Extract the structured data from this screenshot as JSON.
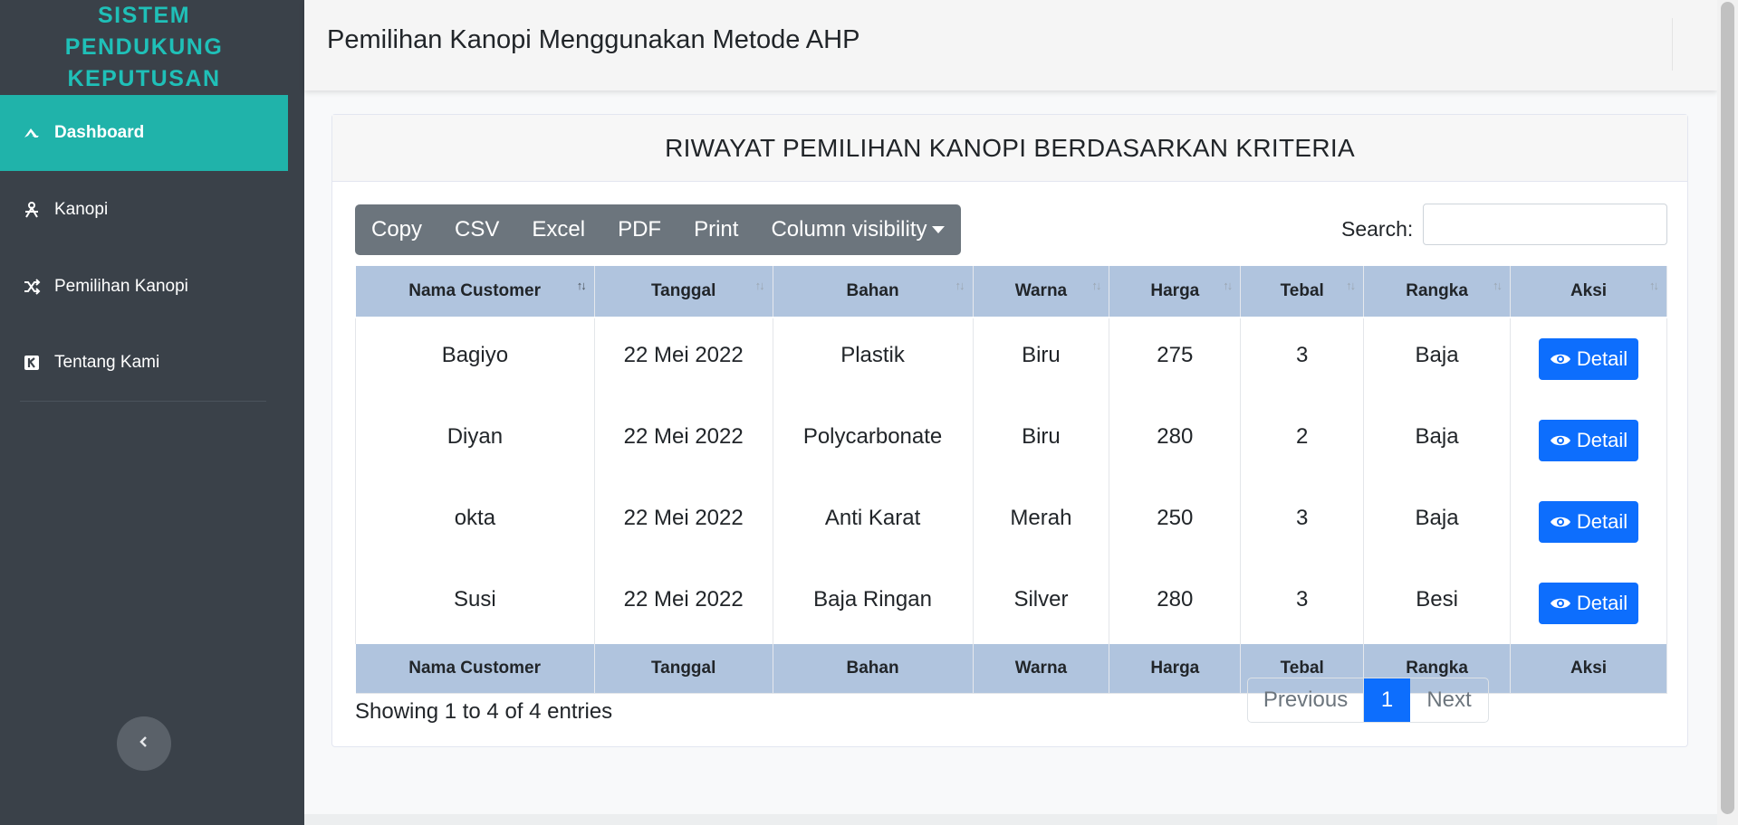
{
  "sidebar": {
    "brand_lines": [
      "SISTEM",
      "PENDUKUNG",
      "KEPUTUSAN"
    ],
    "items": [
      {
        "label": "Dashboard",
        "icon": "dashboard-icon",
        "active": true
      },
      {
        "label": "Kanopi",
        "icon": "kanopi-icon",
        "active": false
      },
      {
        "label": "Pemilihan Kanopi",
        "icon": "shuffle-icon",
        "active": false
      },
      {
        "label": "Tentang Kami",
        "icon": "k-square-icon",
        "active": false
      }
    ],
    "colors": {
      "background": "#3a4149",
      "active": "#20b3aa",
      "brand": "#1fc0b8"
    }
  },
  "header": {
    "title": "Pemilihan Kanopi Menggunakan Metode AHP"
  },
  "card": {
    "title": "RIWAYAT PEMILIHAN KANOPI BERDASARKAN KRITERIA"
  },
  "toolbar": {
    "copy_label": "Copy",
    "csv_label": "CSV",
    "excel_label": "Excel",
    "pdf_label": "PDF",
    "print_label": "Print",
    "column_visibility_label": "Column visibility"
  },
  "search": {
    "label": "Search:",
    "value": "",
    "placeholder": ""
  },
  "table": {
    "columns": [
      "Nama Customer",
      "Tanggal",
      "Bahan",
      "Warna",
      "Harga",
      "Tebal",
      "Rangka",
      "Aksi"
    ],
    "rows": [
      {
        "nama": "Bagiyo",
        "tanggal": "22 Mei 2022",
        "bahan": "Plastik",
        "warna": "Biru",
        "harga": "275",
        "tebal": "3",
        "rangka": "Baja",
        "aksi": "Detail"
      },
      {
        "nama": "Diyan",
        "tanggal": "22 Mei 2022",
        "bahan": "Polycarbonate",
        "warna": "Biru",
        "harga": "280",
        "tebal": "2",
        "rangka": "Baja",
        "aksi": "Detail"
      },
      {
        "nama": "okta",
        "tanggal": "22 Mei 2022",
        "bahan": "Anti Karat",
        "warna": "Merah",
        "harga": "250",
        "tebal": "3",
        "rangka": "Baja",
        "aksi": "Detail"
      },
      {
        "nama": "Susi",
        "tanggal": "22 Mei 2022",
        "bahan": "Baja Ringan",
        "warna": "Silver",
        "harga": "280",
        "tebal": "3",
        "rangka": "Besi",
        "aksi": "Detail"
      }
    ],
    "sort_column": "Nama Customer",
    "header_color": "#b0c4de"
  },
  "footer": {
    "info": "Showing 1 to 4 of 4 entries",
    "pagination": {
      "previous": "Previous",
      "current": "1",
      "next": "Next"
    }
  },
  "colors": {
    "primary": "#0d6efd",
    "button_group": "#6c757d"
  }
}
